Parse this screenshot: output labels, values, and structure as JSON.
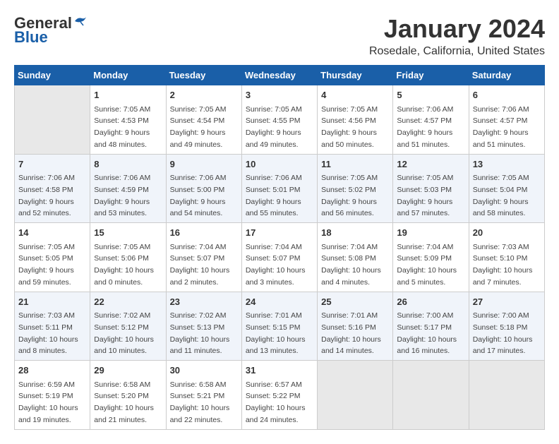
{
  "header": {
    "logo_line1": "General",
    "logo_line2": "Blue",
    "month": "January 2024",
    "location": "Rosedale, California, United States"
  },
  "days_of_week": [
    "Sunday",
    "Monday",
    "Tuesday",
    "Wednesday",
    "Thursday",
    "Friday",
    "Saturday"
  ],
  "weeks": [
    [
      {
        "day": "",
        "info": ""
      },
      {
        "day": "1",
        "info": "Sunrise: 7:05 AM\nSunset: 4:53 PM\nDaylight: 9 hours\nand 48 minutes."
      },
      {
        "day": "2",
        "info": "Sunrise: 7:05 AM\nSunset: 4:54 PM\nDaylight: 9 hours\nand 49 minutes."
      },
      {
        "day": "3",
        "info": "Sunrise: 7:05 AM\nSunset: 4:55 PM\nDaylight: 9 hours\nand 49 minutes."
      },
      {
        "day": "4",
        "info": "Sunrise: 7:05 AM\nSunset: 4:56 PM\nDaylight: 9 hours\nand 50 minutes."
      },
      {
        "day": "5",
        "info": "Sunrise: 7:06 AM\nSunset: 4:57 PM\nDaylight: 9 hours\nand 51 minutes."
      },
      {
        "day": "6",
        "info": "Sunrise: 7:06 AM\nSunset: 4:57 PM\nDaylight: 9 hours\nand 51 minutes."
      }
    ],
    [
      {
        "day": "7",
        "info": "Sunrise: 7:06 AM\nSunset: 4:58 PM\nDaylight: 9 hours\nand 52 minutes."
      },
      {
        "day": "8",
        "info": "Sunrise: 7:06 AM\nSunset: 4:59 PM\nDaylight: 9 hours\nand 53 minutes."
      },
      {
        "day": "9",
        "info": "Sunrise: 7:06 AM\nSunset: 5:00 PM\nDaylight: 9 hours\nand 54 minutes."
      },
      {
        "day": "10",
        "info": "Sunrise: 7:06 AM\nSunset: 5:01 PM\nDaylight: 9 hours\nand 55 minutes."
      },
      {
        "day": "11",
        "info": "Sunrise: 7:05 AM\nSunset: 5:02 PM\nDaylight: 9 hours\nand 56 minutes."
      },
      {
        "day": "12",
        "info": "Sunrise: 7:05 AM\nSunset: 5:03 PM\nDaylight: 9 hours\nand 57 minutes."
      },
      {
        "day": "13",
        "info": "Sunrise: 7:05 AM\nSunset: 5:04 PM\nDaylight: 9 hours\nand 58 minutes."
      }
    ],
    [
      {
        "day": "14",
        "info": "Sunrise: 7:05 AM\nSunset: 5:05 PM\nDaylight: 9 hours\nand 59 minutes."
      },
      {
        "day": "15",
        "info": "Sunrise: 7:05 AM\nSunset: 5:06 PM\nDaylight: 10 hours\nand 0 minutes."
      },
      {
        "day": "16",
        "info": "Sunrise: 7:04 AM\nSunset: 5:07 PM\nDaylight: 10 hours\nand 2 minutes."
      },
      {
        "day": "17",
        "info": "Sunrise: 7:04 AM\nSunset: 5:07 PM\nDaylight: 10 hours\nand 3 minutes."
      },
      {
        "day": "18",
        "info": "Sunrise: 7:04 AM\nSunset: 5:08 PM\nDaylight: 10 hours\nand 4 minutes."
      },
      {
        "day": "19",
        "info": "Sunrise: 7:04 AM\nSunset: 5:09 PM\nDaylight: 10 hours\nand 5 minutes."
      },
      {
        "day": "20",
        "info": "Sunrise: 7:03 AM\nSunset: 5:10 PM\nDaylight: 10 hours\nand 7 minutes."
      }
    ],
    [
      {
        "day": "21",
        "info": "Sunrise: 7:03 AM\nSunset: 5:11 PM\nDaylight: 10 hours\nand 8 minutes."
      },
      {
        "day": "22",
        "info": "Sunrise: 7:02 AM\nSunset: 5:12 PM\nDaylight: 10 hours\nand 10 minutes."
      },
      {
        "day": "23",
        "info": "Sunrise: 7:02 AM\nSunset: 5:13 PM\nDaylight: 10 hours\nand 11 minutes."
      },
      {
        "day": "24",
        "info": "Sunrise: 7:01 AM\nSunset: 5:15 PM\nDaylight: 10 hours\nand 13 minutes."
      },
      {
        "day": "25",
        "info": "Sunrise: 7:01 AM\nSunset: 5:16 PM\nDaylight: 10 hours\nand 14 minutes."
      },
      {
        "day": "26",
        "info": "Sunrise: 7:00 AM\nSunset: 5:17 PM\nDaylight: 10 hours\nand 16 minutes."
      },
      {
        "day": "27",
        "info": "Sunrise: 7:00 AM\nSunset: 5:18 PM\nDaylight: 10 hours\nand 17 minutes."
      }
    ],
    [
      {
        "day": "28",
        "info": "Sunrise: 6:59 AM\nSunset: 5:19 PM\nDaylight: 10 hours\nand 19 minutes."
      },
      {
        "day": "29",
        "info": "Sunrise: 6:58 AM\nSunset: 5:20 PM\nDaylight: 10 hours\nand 21 minutes."
      },
      {
        "day": "30",
        "info": "Sunrise: 6:58 AM\nSunset: 5:21 PM\nDaylight: 10 hours\nand 22 minutes."
      },
      {
        "day": "31",
        "info": "Sunrise: 6:57 AM\nSunset: 5:22 PM\nDaylight: 10 hours\nand 24 minutes."
      },
      {
        "day": "",
        "info": ""
      },
      {
        "day": "",
        "info": ""
      },
      {
        "day": "",
        "info": ""
      }
    ]
  ]
}
